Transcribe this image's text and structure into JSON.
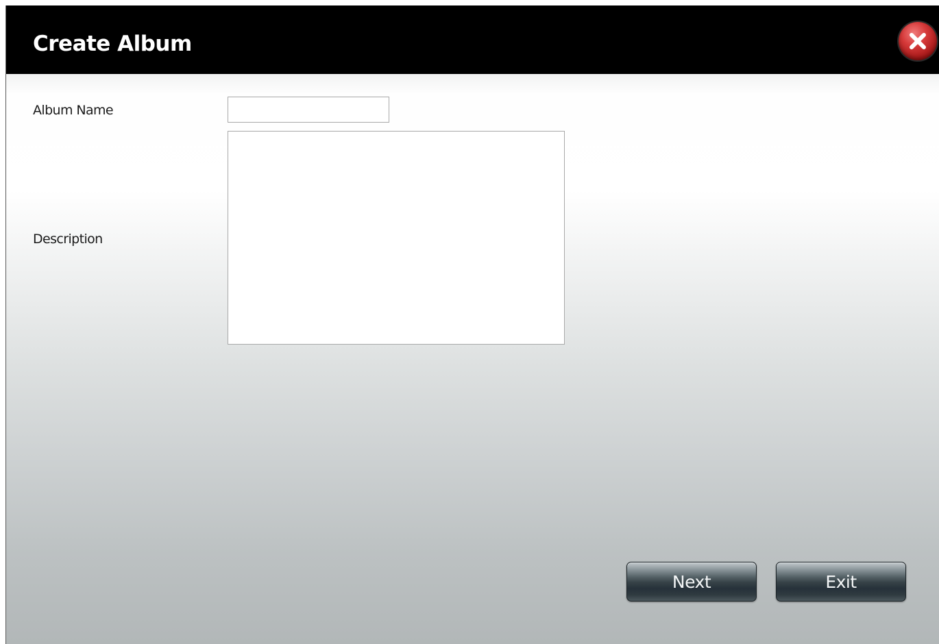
{
  "dialog": {
    "title": "Create Album",
    "close_icon": "close-icon"
  },
  "form": {
    "album_name_label": "Album Name",
    "album_name_value": "",
    "description_label": "Description",
    "description_value": ""
  },
  "buttons": {
    "next_label": "Next",
    "exit_label": "Exit"
  },
  "colors": {
    "titlebar": "#000000",
    "close_button": "#d63a3a",
    "button_dark": "#26313a"
  }
}
